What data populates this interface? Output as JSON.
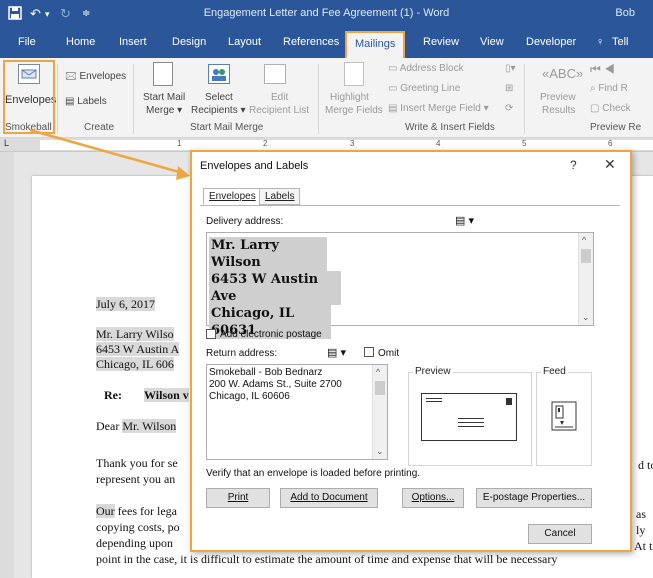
{
  "titlebar": {
    "title": "Engagement Letter and Fee Agreement (1) - Word",
    "user": "Bob",
    "qa_icons": [
      "save-icon",
      "undo-icon",
      "redo-icon",
      "customize-icon"
    ]
  },
  "tabs": [
    {
      "label": "File"
    },
    {
      "label": "Home"
    },
    {
      "label": "Insert"
    },
    {
      "label": "Design"
    },
    {
      "label": "Layout"
    },
    {
      "label": "References"
    },
    {
      "label": "Mailings"
    },
    {
      "label": "Review"
    },
    {
      "label": "View"
    },
    {
      "label": "Developer"
    },
    {
      "label": "Tell"
    }
  ],
  "ribbon": {
    "envelopes_big": "Envelopes",
    "envelopes_small": "Envelopes",
    "labels": "Labels",
    "smokeball_group": "Smokeball",
    "create_group": "Create",
    "start_mail_merge": "Start Mail",
    "start_mail_merge2": "Merge",
    "select": "Select",
    "recipients": "Recipients",
    "edit": "Edit",
    "recipient_list": "Recipient List",
    "start_mail_merge_group": "Start Mail Merge",
    "highlight": "Highlight",
    "merge_fields": "Merge Fields",
    "address_block": "Address Block",
    "greeting_line": "Greeting Line",
    "insert_merge_field": "Insert Merge Field",
    "write_insert_group": "Write & Insert Fields",
    "preview": "Preview",
    "results": "Results",
    "find_r": "Find R",
    "check": "Check",
    "preview_re_group": "Preview Re"
  },
  "ruler": {
    "numbers": [
      "1",
      "2",
      "3",
      "4",
      "5",
      "6"
    ]
  },
  "document": {
    "date": "July 6, 2017",
    "addr1": "Mr. Larry Wilso",
    "addr2": "6453 W Austin A",
    "addr3": "Chicago, IL 606",
    "re_label": "Re:",
    "re_value": "Wilson v",
    "dear_prefix": "Dear",
    "dear_name": "Mr. Wilson",
    "para1_a": "Thank you for se",
    "para1_b": "represent you an",
    "para1_right": "d to",
    "para2_our": "Our",
    "para2_a": " fees for lega",
    "para2_b": "copying costs, po",
    "para2_c": "depending upon",
    "para2_r1": "as",
    "para2_r2": "ly",
    "para2_r3": "At th",
    "para2_d": "point in the case, it is difficult to estimate the amount of time and expense that will be necessary"
  },
  "dialog": {
    "title": "Envelopes and Labels",
    "help": "?",
    "close": "✕",
    "tab_envelopes": "Envelopes",
    "tab_labels": "Labels",
    "delivery_label": "Delivery address:",
    "delivery_lines": [
      "Mr. Larry Wilson",
      "6453 W Austin Ave",
      "Chicago, IL 60631"
    ],
    "add_postage": "Add electronic postage",
    "return_label": "Return address:",
    "omit": "Omit",
    "return_lines": [
      "Smokeball - Bob Bednarz",
      "200 W. Adams St., Suite 2700",
      "Chicago, IL 60606"
    ],
    "preview": "Preview",
    "feed": "Feed",
    "verify": "Verify that an envelope is loaded before printing.",
    "print": "Print",
    "add_to_document": "Add to Document",
    "options": "Options...",
    "e_postage": "E-postage Properties...",
    "cancel": "Cancel"
  },
  "colors": {
    "word_blue": "#2b579a",
    "highlight_orange": "#f0a640"
  }
}
